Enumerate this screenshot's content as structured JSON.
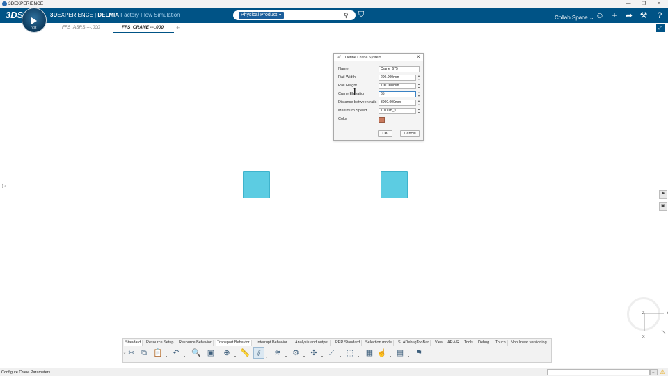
{
  "os_window": {
    "title": "3DEXPERIENCE",
    "minimize": "—",
    "restore": "❐",
    "close": "✕"
  },
  "header": {
    "brand_logo": "3DS",
    "compass_label": "V,R",
    "title_part1": "3D",
    "title_part2": "EXPERIENCE | ",
    "title_part3": "DELMIA",
    "subtitle": "Factory Flow Simulation",
    "search_scope": "Physical Product",
    "search_placeholder": "",
    "collab_space": "Collab Space",
    "icons": [
      "user-icon",
      "plus-icon",
      "share-icon",
      "tools-icon",
      "help-icon"
    ]
  },
  "tabs": [
    {
      "label": "FFS_ASRS ---.000",
      "active": false
    },
    {
      "label": "FFS_CRANE ---.000",
      "active": true
    }
  ],
  "tab_add": "+",
  "dialog": {
    "title": "Define Crane System",
    "fields": [
      {
        "label": "Name",
        "value": "Crane_675",
        "spinner": false
      },
      {
        "label": "Rail Width",
        "value": "200.000mm",
        "spinner": true
      },
      {
        "label": "Rail Height",
        "value": "100.000mm",
        "spinner": true
      },
      {
        "label": "Crane Elevation",
        "value": "65",
        "spinner": true
      },
      {
        "label": "Distance between rails",
        "value": "3000.000mm",
        "spinner": true
      },
      {
        "label": "Maximum Speed",
        "value": "1.100m_s",
        "spinner": true
      }
    ],
    "color_label": "Color",
    "color_value": "#c97a5e",
    "ok_label": "OK",
    "cancel_label": "Cancel"
  },
  "nav_compass": {
    "axis_z": "Z",
    "axis_y": "Y",
    "axis_x": "X"
  },
  "action_bar": {
    "tabs": [
      {
        "label": "Standard",
        "active": true
      },
      {
        "label": "Resource Setup",
        "active": false
      },
      {
        "label": "Resource Behavior",
        "active": false
      },
      {
        "label": "Transport Behavior",
        "active": true
      },
      {
        "label": "Interrupt Behavior",
        "active": false
      },
      {
        "label": "Analysis and output",
        "active": false
      },
      {
        "label": "PPR Standard",
        "active": false
      },
      {
        "label": "Selection mode",
        "active": false
      },
      {
        "label": "SLADebugTooBar",
        "active": false
      },
      {
        "label": "View",
        "active": false
      },
      {
        "label": "AR-VR",
        "active": false
      },
      {
        "label": "Tools",
        "active": false
      },
      {
        "label": "Debug",
        "active": false
      },
      {
        "label": "Touch",
        "active": false
      },
      {
        "label": "Non linear versioning",
        "active": false
      }
    ],
    "tools": [
      "cut-icon",
      "copy-icon",
      "paste-icon",
      "undo-icon",
      "zoom-icon",
      "screen-capture-icon",
      "globe-settings-icon",
      "ruler-icon",
      "crane-rail-icon",
      "conveyor-icon",
      "robot-arm-icon",
      "transport-icon",
      "path-icon",
      "bounding-box-icon",
      "grid-icon",
      "hand-tool-icon",
      "document-icon",
      "settings-robot-icon"
    ]
  },
  "status": {
    "text": "Configure Crane Parameters"
  }
}
